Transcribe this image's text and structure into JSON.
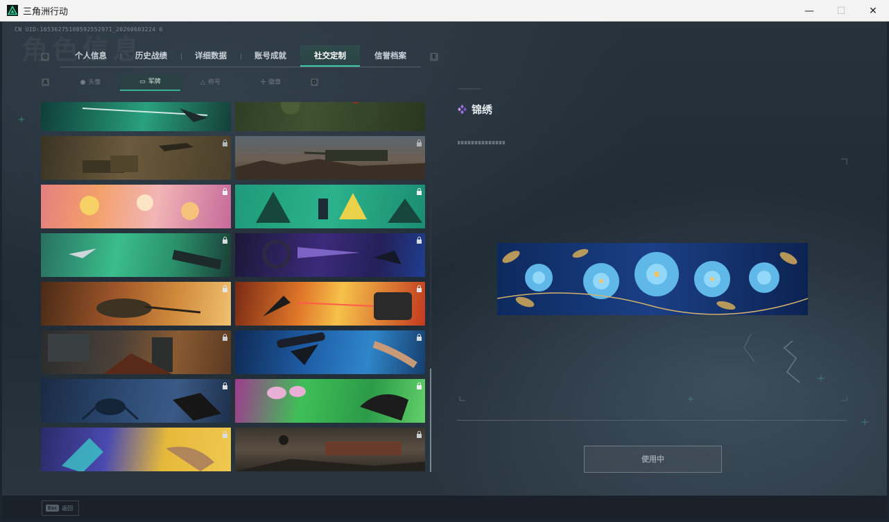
{
  "window": {
    "title": "三角洲行动",
    "controls": {
      "minimize": "—",
      "maximize": "☐",
      "close": "✕"
    }
  },
  "header": {
    "watermark": "角色信息",
    "uid": "CN UID:16536275108592552971_20260603224 6"
  },
  "tabs": {
    "prev_key": "Q",
    "next_key": "E",
    "items": [
      {
        "label": "个人信息"
      },
      {
        "label": "历史战绩"
      },
      {
        "label": "详细数据"
      },
      {
        "label": "账号成就"
      },
      {
        "label": "社交定制",
        "active": true
      },
      {
        "label": "信誉档案"
      }
    ]
  },
  "subtabs": {
    "prev_key": "A",
    "next_key": "D",
    "items": [
      {
        "label": "头像",
        "icon": "person-icon"
      },
      {
        "label": "军牌",
        "icon": "tag-icon",
        "active": true
      },
      {
        "label": "称号",
        "icon": "badge-icon"
      },
      {
        "label": "徽章",
        "icon": "medal-icon"
      }
    ]
  },
  "cards": [
    {
      "theme": "green-spear",
      "locked": false
    },
    {
      "theme": "camo-green",
      "locked": false
    },
    {
      "theme": "helicopter-desert",
      "locked": true
    },
    {
      "theme": "tank-desert",
      "locked": true
    },
    {
      "theme": "pink-cats",
      "locked": true
    },
    {
      "theme": "teal-thumbs",
      "locked": true
    },
    {
      "theme": "green-blade",
      "locked": true
    },
    {
      "theme": "purple-wheel",
      "locked": true
    },
    {
      "theme": "orange-soldiers",
      "locked": true
    },
    {
      "theme": "orange-burst",
      "locked": true
    },
    {
      "theme": "ruins-fire",
      "locked": true
    },
    {
      "theme": "blue-hand",
      "locked": true
    },
    {
      "theme": "navy-robot",
      "locked": true
    },
    {
      "theme": "green-pink-hand",
      "locked": true
    },
    {
      "theme": "purple-yellow-hand",
      "locked": true
    },
    {
      "theme": "wasteland",
      "locked": true
    }
  ],
  "detail": {
    "name": "锦绣",
    "subtitle_placeholder": "",
    "preview_theme": "blue-embroidered-flowers",
    "action_label": "使用中"
  },
  "footer": {
    "esc_key": "Esc",
    "esc_label": "返回"
  },
  "colors": {
    "accent": "#3cc6a5",
    "background": "#1e2932",
    "rare_purple": "#9b6fe0"
  }
}
